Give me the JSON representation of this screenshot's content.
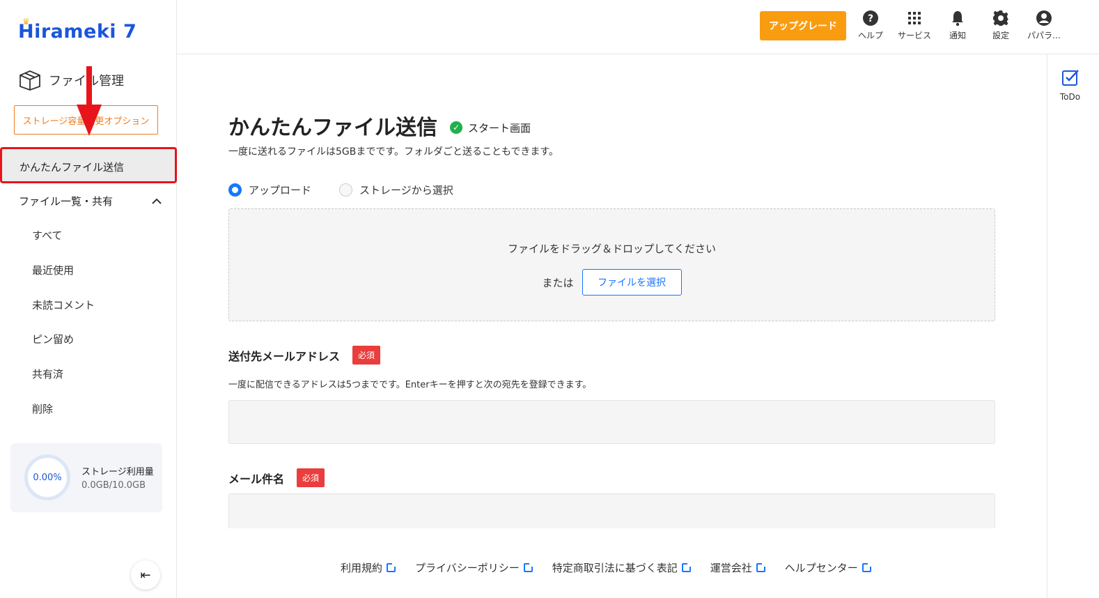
{
  "sidebar": {
    "logo": "Hirameki 7",
    "module": "ファイル管理",
    "storage_option": "ストレージ容量変更オプション",
    "active_item": "かんたんファイル送信",
    "group": "ファイル一覧・共有",
    "items": [
      "すべて",
      "最近使用",
      "未読コメント",
      "ピン留め",
      "共有済",
      "削除"
    ],
    "storage": {
      "percent": "0.00%",
      "title": "ストレージ利用量",
      "value": "0.0GB/10.0GB"
    }
  },
  "header": {
    "upgrade": "アップグレード",
    "icons": [
      {
        "label": "ヘルプ",
        "icon": "help-icon"
      },
      {
        "label": "サービス",
        "icon": "grid-icon"
      },
      {
        "label": "通知",
        "icon": "bell-icon"
      },
      {
        "label": "設定",
        "icon": "gear-icon"
      },
      {
        "label": "パパラ…",
        "icon": "user-icon"
      }
    ]
  },
  "todo": {
    "label": "ToDo"
  },
  "main": {
    "title": "かんたんファイル送信",
    "status": "スタート画面",
    "description": "一度に送れるファイルは5GBまでです。フォルダごと送ることもできます。",
    "radio_upload": "アップロード",
    "radio_storage": "ストレージから選択",
    "dropzone_text": "ファイルをドラッグ＆ドロップしてください",
    "or_text": "または",
    "choose_file": "ファイルを選択",
    "recipient_label": "送付先メールアドレス",
    "required": "必須",
    "recipient_hint": "一度に配信できるアドレスは5つまでです。Enterキーを押すと次の宛先を登録できます。",
    "subject_label": "メール件名"
  },
  "footer": {
    "links": [
      "利用規約",
      "プライバシーポリシー",
      "特定商取引法に基づく表記",
      "運営会社",
      "ヘルプセンター"
    ]
  },
  "colors": {
    "brand": "#1a56db",
    "accent_orange": "#fa9c10",
    "required_red": "#ea3d3d",
    "annotation_red": "#e8141b",
    "success_green": "#21b04b"
  }
}
